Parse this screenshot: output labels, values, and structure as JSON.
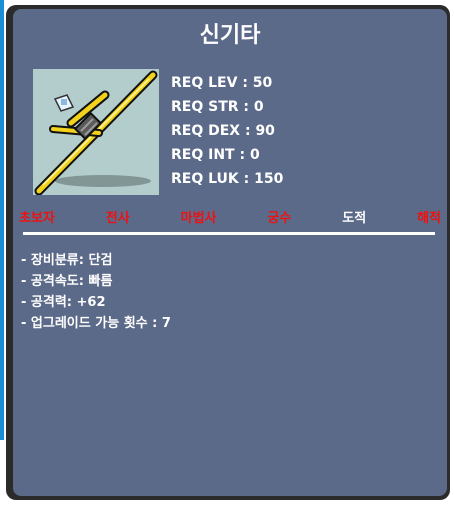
{
  "item": {
    "name": "신기타",
    "icon": "dagger-icon"
  },
  "requirements": [
    "REQ LEV : 50",
    "REQ STR : 0",
    "REQ DEX : 90",
    "REQ INT : 0",
    "REQ LUK : 150"
  ],
  "jobs": [
    {
      "label": "초보자",
      "color": "#ee1111"
    },
    {
      "label": "전사",
      "color": "#ee1111"
    },
    {
      "label": "마법사",
      "color": "#ee1111"
    },
    {
      "label": "궁수",
      "color": "#ee1111"
    },
    {
      "label": "도적",
      "color": "#ffffff"
    },
    {
      "label": "해적",
      "color": "#ee1111"
    }
  ],
  "stats": [
    "- 장비분류: 단검",
    "- 공격속도: 빠름",
    "- 공격력: +62",
    "- 업그레이드 가능 횟수 : 7"
  ],
  "colors": {
    "panel": "#5c6a8a",
    "frame": "#2b2b2b",
    "icon_bg": "#b3cccc",
    "unavailable_job": "#ee1111",
    "available_job": "#ffffff"
  }
}
